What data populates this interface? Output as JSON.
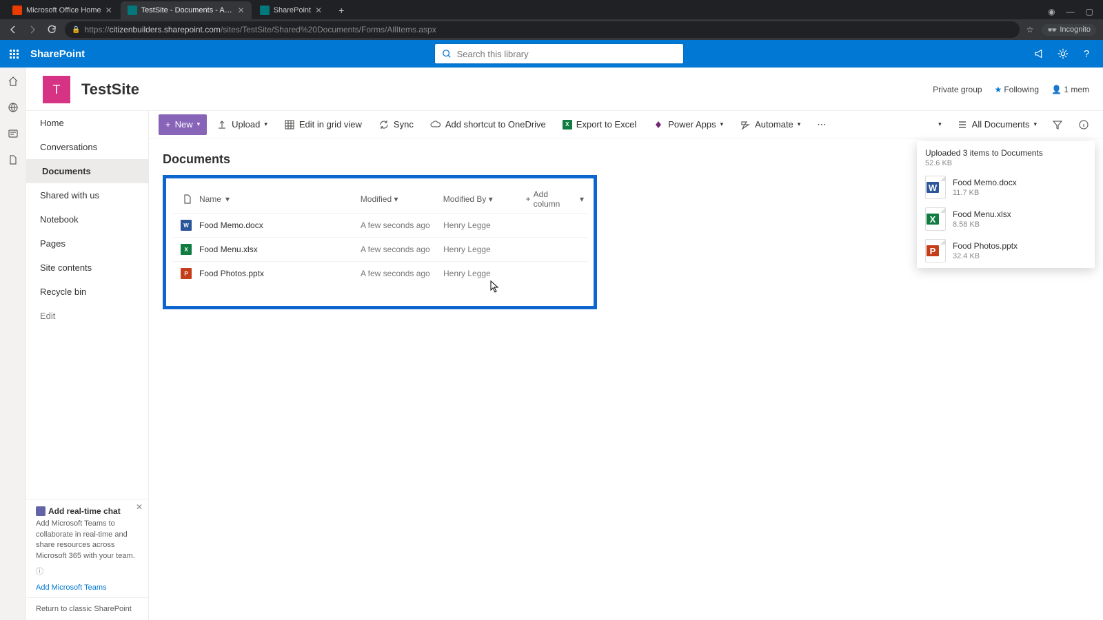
{
  "browser": {
    "tabs": [
      {
        "title": "Microsoft Office Home",
        "favicon_bg": "#eb3c00",
        "favicon_text": "",
        "active": false
      },
      {
        "title": "TestSite - Documents - All Docum",
        "favicon_bg": "#03787c",
        "favicon_text": "",
        "active": true
      },
      {
        "title": "SharePoint",
        "favicon_bg": "#03787c",
        "favicon_text": "",
        "active": false
      }
    ],
    "url_prefix": "https://",
    "url_host": "citizenbuilders.sharepoint.com",
    "url_path": "/sites/TestSite/Shared%20Documents/Forms/AllItems.aspx",
    "incognito_label": "Incognito"
  },
  "suite": {
    "brand": "SharePoint",
    "search_placeholder": "Search this library"
  },
  "site": {
    "logo_letter": "T",
    "title": "TestSite",
    "privacy": "Private group",
    "following": "Following",
    "members": "1 mem"
  },
  "leftnav": {
    "items": [
      "Home",
      "Conversations",
      "Documents",
      "Shared with us",
      "Notebook",
      "Pages",
      "Site contents",
      "Recycle bin"
    ],
    "selected_index": 2,
    "edit": "Edit",
    "teaser_title": "Add real-time chat",
    "teaser_body": "Add Microsoft Teams to collaborate in real-time and share resources across Microsoft 365 with your team.",
    "teaser_link": "Add Microsoft Teams",
    "return": "Return to classic SharePoint"
  },
  "cmdbar": {
    "new": "New",
    "upload": "Upload",
    "edit_grid": "Edit in grid view",
    "sync": "Sync",
    "onedrive": "Add shortcut to OneDrive",
    "excel": "Export to Excel",
    "powerapps": "Power Apps",
    "automate": "Automate",
    "view_label": "All Documents"
  },
  "library": {
    "title": "Documents",
    "columns": {
      "name": "Name",
      "modified": "Modified",
      "modified_by": "Modified By",
      "add": "Add column"
    },
    "rows": [
      {
        "icon_color": "#2b579a",
        "icon_label": "W",
        "name": "Food Memo.docx",
        "modified": "A few seconds ago",
        "by": "Henry Legge"
      },
      {
        "icon_color": "#107c41",
        "icon_label": "X",
        "name": "Food Menu.xlsx",
        "modified": "A few seconds ago",
        "by": "Henry Legge"
      },
      {
        "icon_color": "#c43e1c",
        "icon_label": "P",
        "name": "Food Photos.pptx",
        "modified": "A few seconds ago",
        "by": "Henry Legge"
      }
    ]
  },
  "toast": {
    "heading": "Uploaded 3 items to Documents",
    "total": "52.6 KB",
    "items": [
      {
        "icon_color": "#2b579a",
        "icon_label": "W",
        "name": "Food Memo.docx",
        "size": "11.7 KB"
      },
      {
        "icon_color": "#107c41",
        "icon_label": "X",
        "name": "Food Menu.xlsx",
        "size": "8.58 KB"
      },
      {
        "icon_color": "#c43e1c",
        "icon_label": "P",
        "name": "Food Photos.pptx",
        "size": "32.4 KB"
      }
    ]
  }
}
